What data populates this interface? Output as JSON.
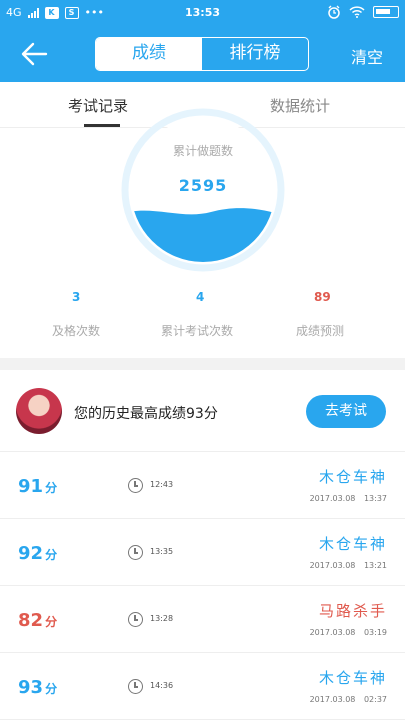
{
  "status": {
    "network": "4G",
    "time": "13:53"
  },
  "nav": {
    "tab_active": "成绩",
    "tab_other": "排行榜",
    "clear_label": "清空"
  },
  "subtabs": {
    "records": "考试记录",
    "stats": "数据统计"
  },
  "gauge": {
    "label": "累计做题数",
    "value": "2595"
  },
  "stats": [
    {
      "value": "3",
      "label": "及格次数",
      "color": "#29a6ee"
    },
    {
      "value": "4",
      "label": "累计考试次数",
      "color": "#29a6ee"
    },
    {
      "value": "89",
      "label": "成绩预测",
      "color": "#e05a4e"
    }
  ],
  "profile": {
    "best_text": "您的历史最高成绩93分",
    "button": "去考试"
  },
  "records": [
    {
      "score": "91",
      "unit": "分",
      "duration": "12:43",
      "title": "木仓车神",
      "date": "2017.03.08 13:37",
      "color": "blue"
    },
    {
      "score": "92",
      "unit": "分",
      "duration": "13:35",
      "title": "木仓车神",
      "date": "2017.03.08 13:21",
      "color": "blue"
    },
    {
      "score": "82",
      "unit": "分",
      "duration": "13:28",
      "title": "马路杀手",
      "date": "2017.03.08 03:19",
      "color": "red"
    },
    {
      "score": "93",
      "unit": "分",
      "duration": "14:36",
      "title": "木仓车神",
      "date": "2017.03.08 02:37",
      "color": "blue"
    }
  ]
}
